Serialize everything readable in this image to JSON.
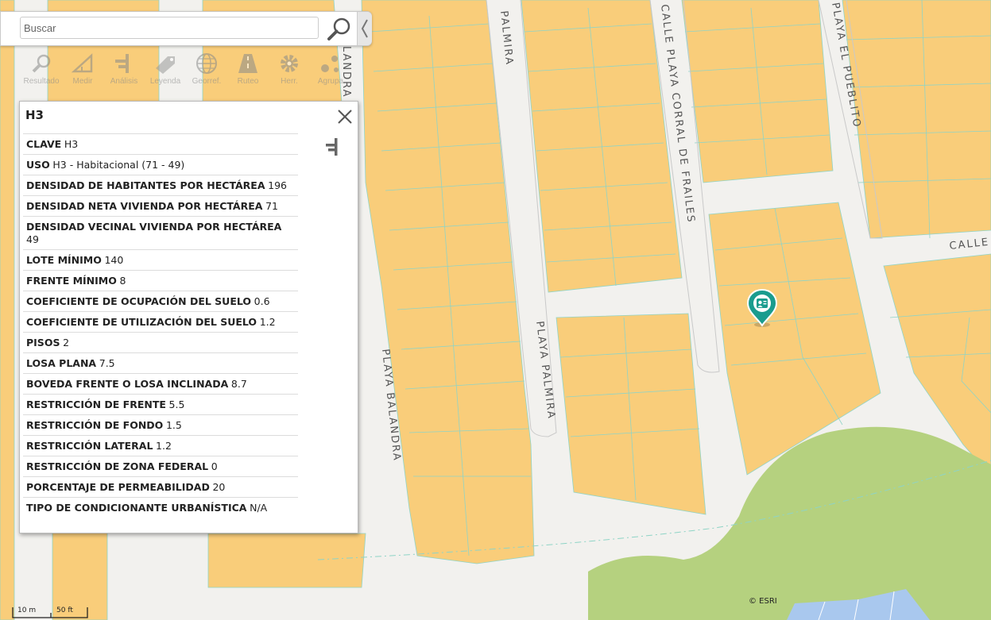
{
  "search": {
    "placeholder": "Buscar",
    "value": ""
  },
  "toolbar": {
    "tools": [
      {
        "label": "Resultado"
      },
      {
        "label": "Medir"
      },
      {
        "label": "Análisis"
      },
      {
        "label": "Leyenda"
      },
      {
        "label": "Georref."
      },
      {
        "label": "Ruteo"
      },
      {
        "label": "Herr."
      },
      {
        "label": "Agrupa"
      }
    ]
  },
  "popup": {
    "title": "H3",
    "attributes": [
      {
        "key": "CLAVE",
        "value": "H3"
      },
      {
        "key": "USO",
        "value": "H3 - Habitacional (71 - 49)"
      },
      {
        "key": "DENSIDAD DE HABITANTES POR HECTÁREA",
        "value": "196"
      },
      {
        "key": "DENSIDAD NETA VIVIENDA POR HECTÁREA",
        "value": "71"
      },
      {
        "key": "DENSIDAD VECINAL VIVIENDA POR HECTÁREA",
        "value": "49"
      },
      {
        "key": "LOTE MÍNIMO",
        "value": "140"
      },
      {
        "key": "FRENTE MÍNIMO",
        "value": "8"
      },
      {
        "key": "COEFICIENTE DE OCUPACIÓN DEL SUELO",
        "value": "0.6"
      },
      {
        "key": "COEFICIENTE DE UTILIZACIÓN DEL SUELO",
        "value": "1.2"
      },
      {
        "key": "PISOS",
        "value": "2"
      },
      {
        "key": "LOSA PLANA",
        "value": "7.5"
      },
      {
        "key": "BOVEDA FRENTE O LOSA INCLINADA",
        "value": "8.7"
      },
      {
        "key": "RESTRICCIÓN DE FRENTE",
        "value": "5.5"
      },
      {
        "key": "RESTRICCIÓN DE FONDO",
        "value": "1.5"
      },
      {
        "key": "RESTRICCIÓN LATERAL",
        "value": "1.2"
      },
      {
        "key": "RESTRICCIÓN DE ZONA FEDERAL",
        "value": "0"
      },
      {
        "key": "PORCENTAJE DE PERMEABILIDAD",
        "value": "20"
      },
      {
        "key": "TIPO DE CONDICIONANTE URBANÍSTICA",
        "value": "N/A"
      }
    ]
  },
  "map": {
    "streets": {
      "palmira_north": "PALMIRA",
      "corral_de_frailes": "CALLE PLAYA CORRAL DE FRAILES",
      "el_pueblito": "PLAYA EL PUEBLITO",
      "calle_east": "CALLE",
      "balandra_north": "LANDRA",
      "balandra_south": "PLAYA BALANDRA",
      "palmira_south": "PLAYA PALMIRA"
    },
    "colors": {
      "zone": "#f9cd7a",
      "road": "#f2f1ee",
      "park": "#b5d17f",
      "water": "#a9c8ee"
    }
  },
  "scale": {
    "metric": "10 m",
    "imperial": "50 ft"
  },
  "attribution": "© ESRI"
}
